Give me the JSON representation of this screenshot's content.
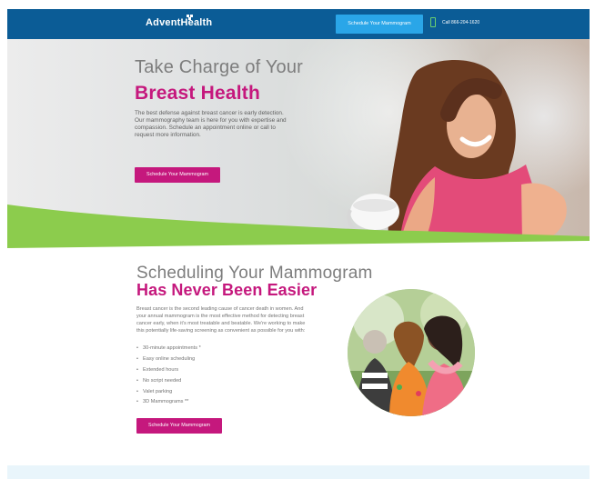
{
  "header": {
    "logo_text": "AdventHealth",
    "cta_label": "Schedule Your Mammogram",
    "phone": "Call 866-204-1620"
  },
  "hero": {
    "title_light": "Take Charge of Your",
    "title_bold": "Breast Health",
    "body": "The best defense against breast cancer is early detection. Our mammography team is here for you with expertise and compassion. Schedule an appointment online or call to request more information.",
    "button_label": "Schedule Your Mammogram"
  },
  "scheduling": {
    "title_light": "Scheduling Your Mammogram",
    "title_bold": "Has Never Been Easier",
    "body": "Breast cancer is the second leading cause of cancer death in women. And your annual mammogram is the most effective method for detecting breast cancer early, when it's most treatable and beatable. We're working to make this potentially life-saving screening as convenient as possible for you with:",
    "items": [
      "30-minute appointments *",
      "Easy online scheduling",
      "Extended hours",
      "No script needed",
      "Valet parking",
      "3D Mammograms **"
    ],
    "button_label": "Schedule Your Mammogram"
  },
  "colors": {
    "header_blue": "#0b5c96",
    "brand_pink": "#c5187d",
    "cta_blue": "#2aa6e8",
    "phone_green": "#6cd16f",
    "hero_green": "#8ccc4d"
  },
  "icons": {
    "logo_mark": "flower-cross-icon",
    "phone": "phone-icon"
  }
}
